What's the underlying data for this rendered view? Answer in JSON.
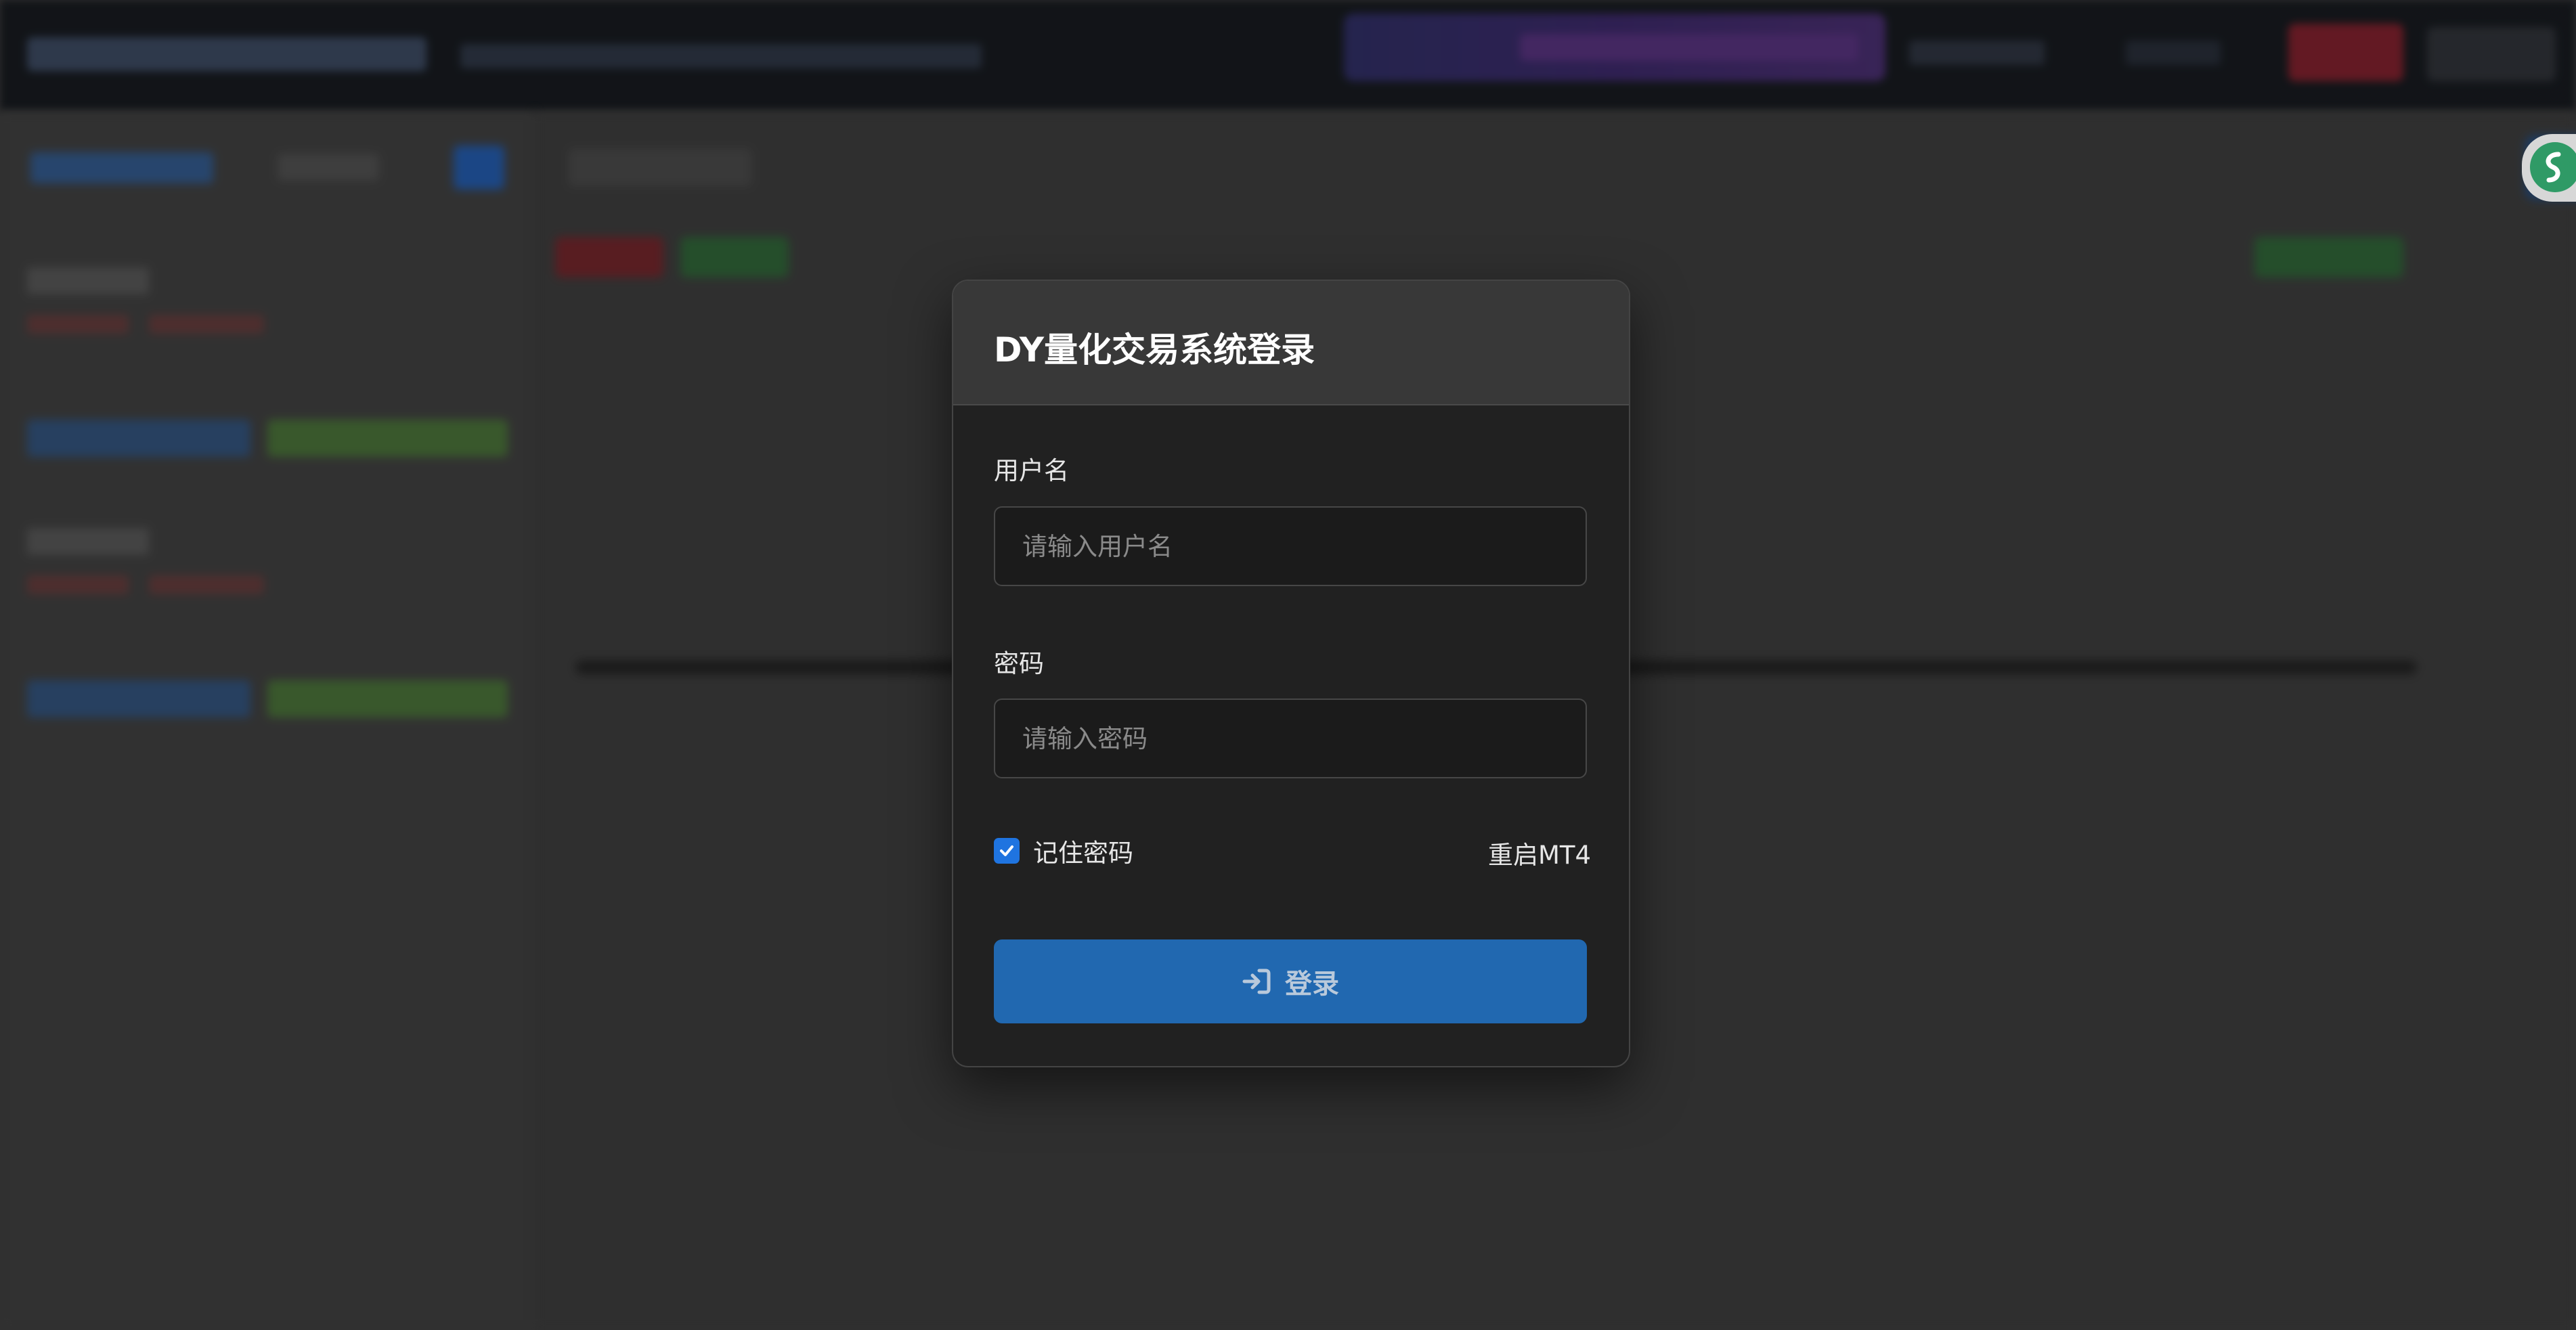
{
  "login_modal": {
    "title": "DY量化交易系统登录",
    "username": {
      "label": "用户名",
      "placeholder": "请输入用户名",
      "value": ""
    },
    "password": {
      "label": "密码",
      "placeholder": "请输入密码",
      "value": ""
    },
    "remember_password": {
      "label": "记住密码",
      "checked": true
    },
    "restart_link_label": "重启MT4",
    "login_button": {
      "label": "登录",
      "icon": "sign-in-icon"
    }
  },
  "colors": {
    "accent": "#2168b0",
    "checkbox": "#1f74e0",
    "modal_bg": "#212121",
    "header_bg": "#383838"
  }
}
